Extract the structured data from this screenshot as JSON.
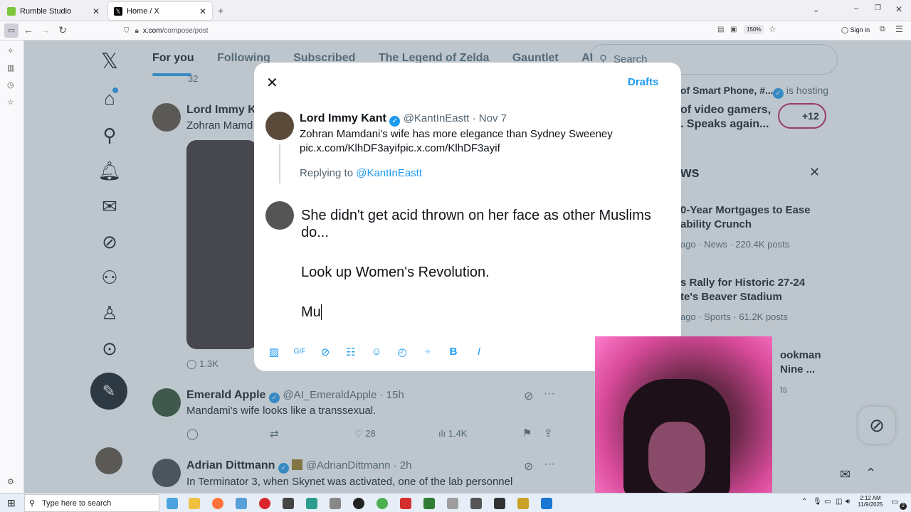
{
  "browser": {
    "tabs": [
      {
        "label": "Rumble Studio",
        "active": false
      },
      {
        "label": "Home / X",
        "active": true
      }
    ],
    "url_host": "x.com",
    "url_path": "/compose/post",
    "zoom": "150%",
    "sign_in": "Sign in"
  },
  "feed": {
    "tabs": [
      "For you",
      "Following",
      "Subscribed",
      "The Legend of Zelda",
      "Gauntlet",
      "AI"
    ],
    "search_placeholder": "Search",
    "top_count": "32",
    "posts": [
      {
        "name": "Lord Immy Ka",
        "text": "Zohran Mamd",
        "replies": "1.3K"
      },
      {
        "name": "Emerald Apple",
        "handle": "@AI_EmeraldApple · 15h",
        "text": "Mandami's wife looks like a transsexual.",
        "likes": "28",
        "views": "1.4K"
      },
      {
        "name": "Adrian Dittmann",
        "handle": "@AdrianDittmann · 2h",
        "text": "In Terminator 3, when Skynet was activated, one of the lab personnel"
      }
    ]
  },
  "right": {
    "hosting_line": "of Smart Phone, #...",
    "hosting_suffix": "is hosting",
    "space_line1": "of video gamers,",
    "space_line2": ". Speaks again...",
    "plus_count": "+12",
    "news_header": "ws",
    "news": [
      {
        "title1": "0-Year Mortgages to Ease",
        "title2": "ability Crunch",
        "meta": "ago · News · 220.4K posts"
      },
      {
        "title1": "s Rally for Historic 27-24",
        "title2": "te's Beaver Stadium",
        "meta": "ago · Sports · 61.2K posts"
      },
      {
        "title1": "ookman",
        "title2": "Nine ...",
        "meta": "ts"
      }
    ]
  },
  "modal": {
    "drafts": "Drafts",
    "quoted_name": "Lord Immy Kant",
    "quoted_handle": "@KantInEastt · Nov 7",
    "quoted_text": "Zohran Mamdani's wife has more elegance than Sydney Sweeney",
    "quoted_link": "pic.x.com/KlhDF3ayifpic.x.com/KlhDF3ayif",
    "replying_prefix": "Replying to",
    "replying_handle": "@KantInEastt",
    "draft_line1": "She didn't get acid thrown on her face as other Muslims",
    "draft_line2": "do...",
    "draft_line3": "Look up Women's Revolution.",
    "draft_line4": "Mu"
  },
  "taskbar": {
    "search_placeholder": "Type here to search",
    "time": "2:12 AM",
    "date": "11/9/2025",
    "notif_count": "2"
  }
}
